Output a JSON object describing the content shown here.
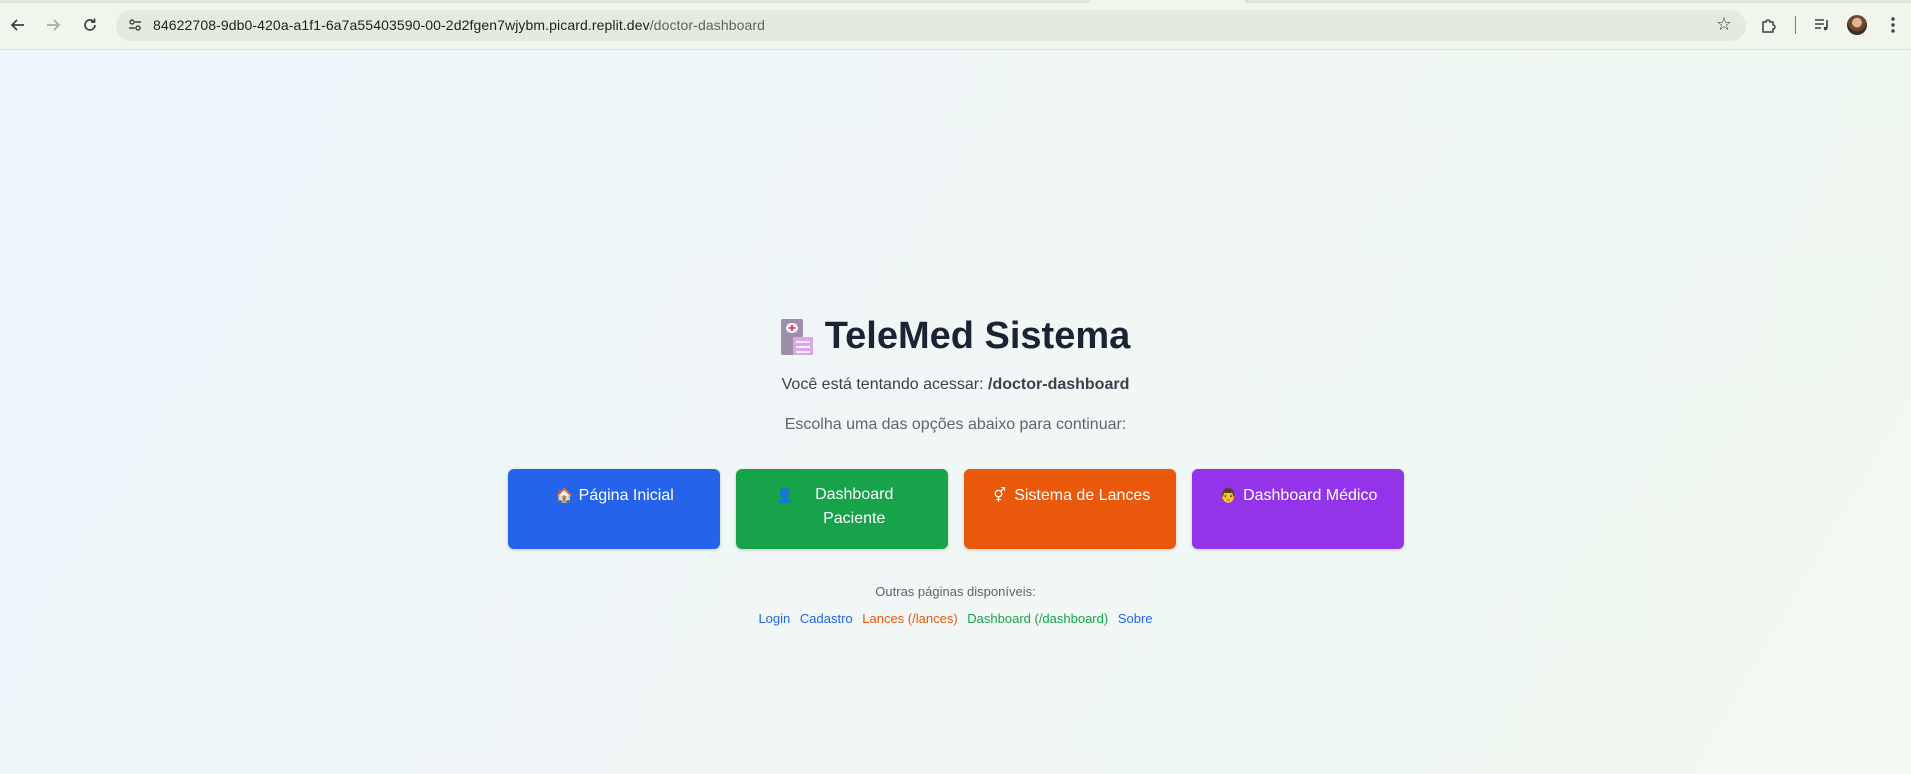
{
  "browser": {
    "url_host": "84622708-9db0-420a-a1f1-6a7a55403590-00-2d2fgen7wjybm.picard.replit.dev",
    "url_path": "/doctor-dashboard"
  },
  "page": {
    "title": "TeleMed Sistema",
    "subtitle_prefix": "Você está tentando acessar:",
    "subtitle_path": "/doctor-dashboard",
    "prompt": "Escolha uma das opções abaixo para continuar:",
    "buttons": [
      {
        "icon": "🏠",
        "label": "Página Inicial",
        "color": "#2663eb"
      },
      {
        "icon": "👤",
        "label": "Dashboard Paciente",
        "color": "#16a34a"
      },
      {
        "icon": "⚥",
        "label": "Sistema de Lances",
        "color": "#ea580c"
      },
      {
        "icon": "👨",
        "label": "Dashboard Médico",
        "color": "#9333ea"
      }
    ],
    "others_label": "Outras páginas disponíveis:",
    "links": [
      {
        "label": "Login",
        "color": "#2563eb"
      },
      {
        "label": "Cadastro",
        "color": "#2563eb"
      },
      {
        "label": "Lances (/lances)",
        "color": "#ea580c"
      },
      {
        "label": "Dashboard (/dashboard)",
        "color": "#16a34a"
      },
      {
        "label": "Sobre",
        "color": "#2563eb"
      }
    ]
  }
}
